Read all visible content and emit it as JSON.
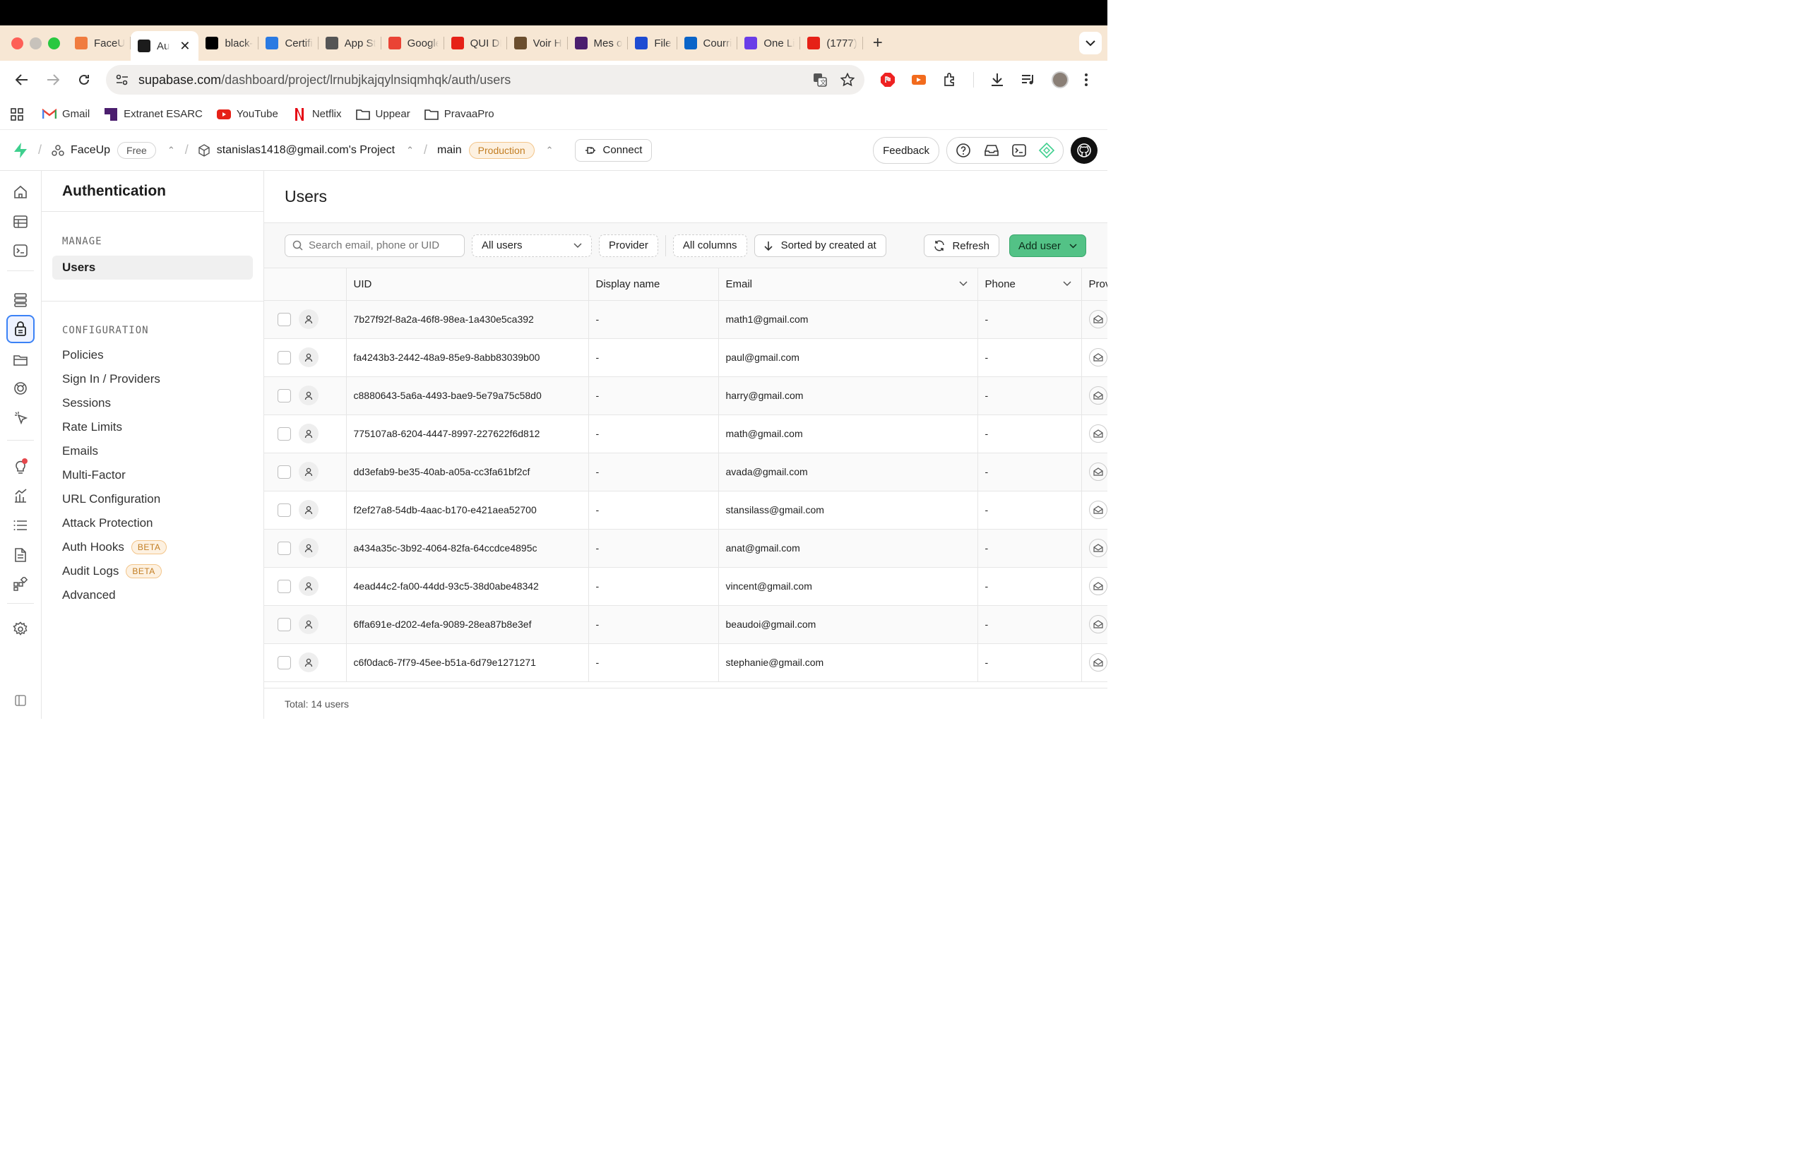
{
  "browser": {
    "tabs": [
      {
        "label": "FaceU",
        "color": "#f07c3f"
      },
      {
        "label": "Au",
        "color": "#1c1c1c",
        "active": true
      },
      {
        "label": "black-",
        "color": "#000000"
      },
      {
        "label": "Certifi",
        "color": "#2a7ae2"
      },
      {
        "label": "App St",
        "color": "#555555"
      },
      {
        "label": "Google",
        "color": "#ea4335"
      },
      {
        "label": "QUI DI",
        "color": "#e62117"
      },
      {
        "label": "Voir H",
        "color": "#6b4e2e"
      },
      {
        "label": "Mes o",
        "color": "#4b1e6e"
      },
      {
        "label": "File",
        "color": "#1e4bd2"
      },
      {
        "label": "Courri",
        "color": "#0a64c8"
      },
      {
        "label": "One Li",
        "color": "#6a3de8"
      },
      {
        "label": "(1777)",
        "color": "#e62117"
      }
    ],
    "url_host": "supabase.com",
    "url_path": "/dashboard/project/lrnubjkajqylnsiqmhqk/auth/users",
    "bookmarks": [
      "Gmail",
      "Extranet ESARC",
      "YouTube",
      "Netflix",
      "Uppear",
      "PravaaPro"
    ]
  },
  "header": {
    "org": "FaceUp",
    "org_plan": "Free",
    "project": "stanislas1418@gmail.com's Project",
    "branch": "main",
    "branch_badge": "Production",
    "connect": "Connect",
    "feedback": "Feedback"
  },
  "menu": {
    "title": "Authentication",
    "manage_label": "MANAGE",
    "manage_items": [
      "Users"
    ],
    "config_label": "CONFIGURATION",
    "config_items": [
      "Policies",
      "Sign In / Providers",
      "Sessions",
      "Rate Limits",
      "Emails",
      "Multi-Factor",
      "URL Configuration",
      "Attack Protection",
      "Auth Hooks",
      "Audit Logs",
      "Advanced"
    ],
    "beta": "BETA"
  },
  "page": {
    "title": "Users",
    "search_placeholder": "Search email, phone or UID",
    "filter_users": "All users",
    "filter_provider": "Provider",
    "columns_btn": "All columns",
    "sort_btn": "Sorted by created at",
    "refresh": "Refresh",
    "add_user": "Add user",
    "total": "Total: 14 users"
  },
  "table": {
    "headers": [
      "UID",
      "Display name",
      "Email",
      "Phone",
      "Prov"
    ],
    "rows": [
      {
        "uid": "7b27f92f-8a2a-46f8-98ea-1a430e5ca392",
        "name": "-",
        "email": "math1@gmail.com",
        "phone": "-"
      },
      {
        "uid": "fa4243b3-2442-48a9-85e9-8abb83039b00",
        "name": "-",
        "email": "paul@gmail.com",
        "phone": "-"
      },
      {
        "uid": "c8880643-5a6a-4493-bae9-5e79a75c58d0",
        "name": "-",
        "email": "harry@gmail.com",
        "phone": "-"
      },
      {
        "uid": "775107a8-6204-4447-8997-227622f6d812",
        "name": "-",
        "email": "math@gmail.com",
        "phone": "-"
      },
      {
        "uid": "dd3efab9-be35-40ab-a05a-cc3fa61bf2cf",
        "name": "-",
        "email": "avada@gmail.com",
        "phone": "-"
      },
      {
        "uid": "f2ef27a8-54db-4aac-b170-e421aea52700",
        "name": "-",
        "email": "stansilass@gmail.com",
        "phone": "-"
      },
      {
        "uid": "a434a35c-3b92-4064-82fa-64ccdce4895c",
        "name": "-",
        "email": "anat@gmail.com",
        "phone": "-"
      },
      {
        "uid": "4ead44c2-fa00-44dd-93c5-38d0abe48342",
        "name": "-",
        "email": "vincent@gmail.com",
        "phone": "-"
      },
      {
        "uid": "6ffa691e-d202-4efa-9089-28ea87b8e3ef",
        "name": "-",
        "email": "beaudoi@gmail.com",
        "phone": "-"
      },
      {
        "uid": "c6f0dac6-7f79-45ee-b51a-6d79e1271271",
        "name": "-",
        "email": "stephanie@gmail.com",
        "phone": "-"
      }
    ]
  },
  "colors": {
    "brand": "#3ecf8e",
    "accent_button": "#53c286",
    "badge": "#c27d22"
  }
}
